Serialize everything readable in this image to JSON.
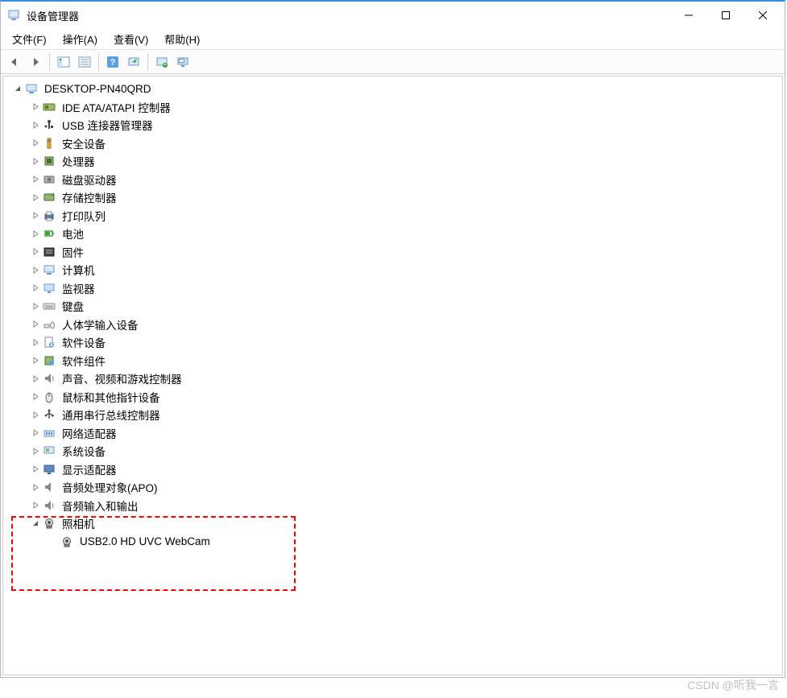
{
  "window": {
    "title": "设备管理器"
  },
  "menu": {
    "file": "文件(F)",
    "action": "操作(A)",
    "view": "查看(V)",
    "help": "帮助(H)"
  },
  "toolbar": {
    "back": "back",
    "forward": "forward",
    "show_hide": "show-hide-tree",
    "list": "list",
    "help": "help",
    "action_green": "scan-hardware",
    "refresh": "refresh",
    "monitor": "remote-monitor"
  },
  "tree": {
    "root": {
      "label": "DESKTOP-PN40QRD",
      "expanded": true
    },
    "categories": [
      {
        "label": "IDE ATA/ATAPI 控制器",
        "icon": "ide",
        "expanded": false
      },
      {
        "label": "USB 连接器管理器",
        "icon": "usb-connector",
        "expanded": false
      },
      {
        "label": "安全设备",
        "icon": "security",
        "expanded": false
      },
      {
        "label": "处理器",
        "icon": "cpu",
        "expanded": false
      },
      {
        "label": "磁盘驱动器",
        "icon": "disk",
        "expanded": false
      },
      {
        "label": "存储控制器",
        "icon": "storage",
        "expanded": false
      },
      {
        "label": "打印队列",
        "icon": "printer",
        "expanded": false
      },
      {
        "label": "电池",
        "icon": "battery",
        "expanded": false
      },
      {
        "label": "固件",
        "icon": "firmware",
        "expanded": false
      },
      {
        "label": "计算机",
        "icon": "computer",
        "expanded": false
      },
      {
        "label": "监视器",
        "icon": "monitor",
        "expanded": false
      },
      {
        "label": "键盘",
        "icon": "keyboard",
        "expanded": false
      },
      {
        "label": "人体学输入设备",
        "icon": "hid",
        "expanded": false
      },
      {
        "label": "软件设备",
        "icon": "software-device",
        "expanded": false
      },
      {
        "label": "软件组件",
        "icon": "software-component",
        "expanded": false
      },
      {
        "label": "声音、视频和游戏控制器",
        "icon": "sound",
        "expanded": false
      },
      {
        "label": "鼠标和其他指针设备",
        "icon": "mouse",
        "expanded": false
      },
      {
        "label": "通用串行总线控制器",
        "icon": "usb",
        "expanded": false,
        "selected": true
      },
      {
        "label": "网络适配器",
        "icon": "network",
        "expanded": false
      },
      {
        "label": "系统设备",
        "icon": "system",
        "expanded": false
      },
      {
        "label": "显示适配器",
        "icon": "display",
        "expanded": false
      },
      {
        "label": "音频处理对象(APO)",
        "icon": "apo",
        "expanded": false
      },
      {
        "label": "音频输入和输出",
        "icon": "audio-io",
        "expanded": false
      },
      {
        "label": "照相机",
        "icon": "camera",
        "expanded": true,
        "children": [
          {
            "label": "USB2.0 HD UVC WebCam",
            "icon": "camera"
          }
        ]
      }
    ]
  },
  "watermark": "CSDN @听我一言"
}
